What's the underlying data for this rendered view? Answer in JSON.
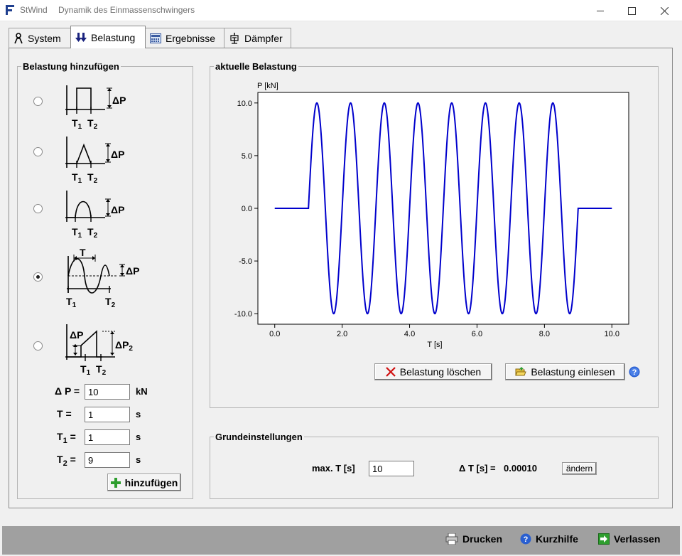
{
  "window": {
    "app_name": "StWind",
    "subtitle": "Dynamik des Einmassenschwingers"
  },
  "tabs": [
    {
      "label": "System",
      "icon": "person-icon",
      "active": false
    },
    {
      "label": "Belastung",
      "icon": "double-arrow-down-icon",
      "active": true
    },
    {
      "label": "Ergebnisse",
      "icon": "calculator-icon",
      "active": false
    },
    {
      "label": "Dämpfer",
      "icon": "damper-icon",
      "active": false
    }
  ],
  "add_load": {
    "legend": "Belastung hinzufügen",
    "load_types": [
      {
        "name": "rectangle",
        "selected": false,
        "dp": "ΔP",
        "t1": "T",
        "t1_sub": "1",
        "t2": "T",
        "t2_sub": "2"
      },
      {
        "name": "triangle",
        "selected": false,
        "dp": "ΔP",
        "t1": "T",
        "t1_sub": "1",
        "t2": "T",
        "t2_sub": "2"
      },
      {
        "name": "half-sine",
        "selected": false,
        "dp": "ΔP",
        "t1": "T",
        "t1_sub": "1",
        "t2": "T",
        "t2_sub": "2"
      },
      {
        "name": "sine",
        "selected": true,
        "dp": "ΔP",
        "period": "T",
        "t1": "T",
        "t1_sub": "1",
        "t2": "T",
        "t2_sub": "2"
      },
      {
        "name": "ramp",
        "selected": false,
        "dp": "ΔP",
        "dp2": "ΔP",
        "dp2_sub": "2",
        "t1": "T",
        "t1_sub": "1",
        "t2": "T",
        "t2_sub": "2"
      }
    ],
    "params": {
      "dp_label": "Δ P  =",
      "dp_value": "10",
      "dp_unit": "kN",
      "t_label": "T =",
      "t_value": "1",
      "t_unit": "s",
      "t1_label": "T",
      "t1_sub": "1",
      "t1_eq": " =",
      "t1_value": "1",
      "t1_unit": "s",
      "t2_label": "T",
      "t2_sub": "2",
      "t2_eq": " =",
      "t2_value": "9",
      "t2_unit": "s"
    },
    "add_button": "hinzufügen"
  },
  "current_load": {
    "legend": "aktuelle Belastung",
    "delete_button": "Belastung löschen",
    "import_button": "Belastung einlesen"
  },
  "settings": {
    "legend": "Grundeinstellungen",
    "max_t_label": "max. T [s]",
    "max_t_value": "10",
    "dt_label": "Δ T [s] =",
    "dt_value": "0.00010",
    "change_button": "ändern"
  },
  "footer": {
    "print": "Drucken",
    "help": "Kurzhilfe",
    "exit": "Verlassen"
  },
  "chart_data": {
    "type": "line",
    "title": "",
    "xlabel": "T [s]",
    "ylabel": "P [kN]",
    "xlim": [
      -0.5,
      10.5
    ],
    "ylim": [
      -11,
      11
    ],
    "xticks": [
      0.0,
      2.0,
      4.0,
      6.0,
      8.0,
      10.0
    ],
    "xtick_labels": [
      "0.0",
      "2.0",
      "4.0",
      "6.0",
      "8.0",
      "10.0"
    ],
    "yticks": [
      10.0,
      5.0,
      0.0,
      -5.0,
      -10.0
    ],
    "ytick_labels": [
      "10.0",
      "5.0",
      "0.0",
      "-5.0",
      "-10.0"
    ],
    "color": "#0000cc",
    "grid": false,
    "series": [
      {
        "kind": "piecewise-sine",
        "x_start": 0,
        "x_end": 10,
        "sine_start": 1,
        "sine_end": 9,
        "amplitude": 10,
        "period": 1
      }
    ]
  }
}
